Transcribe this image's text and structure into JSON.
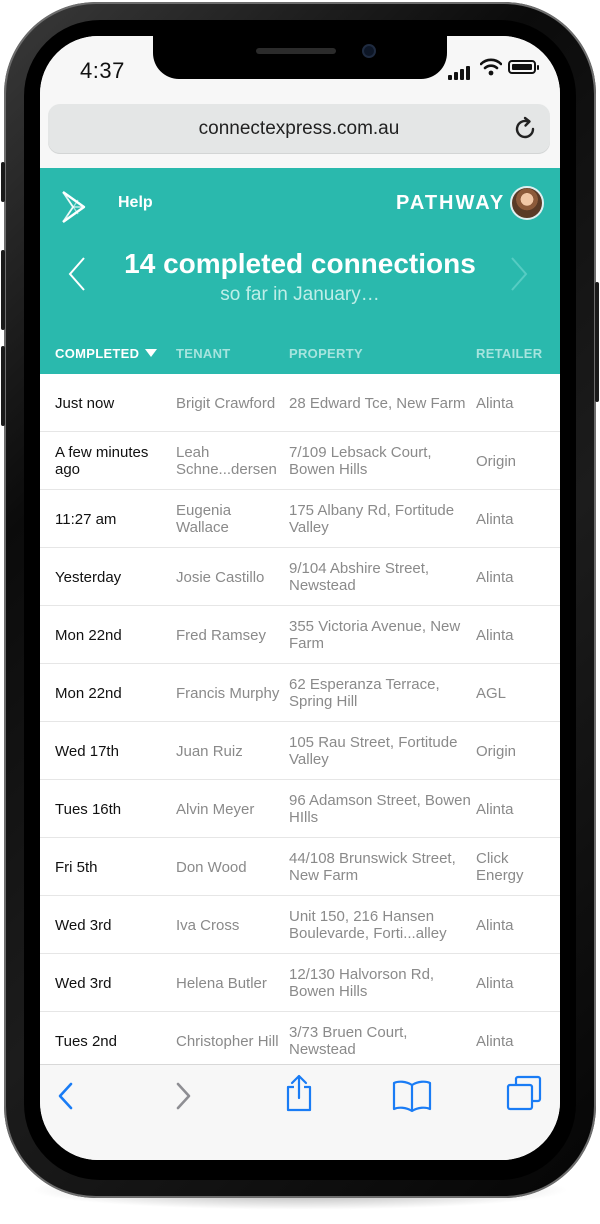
{
  "status_bar": {
    "time": "4:37"
  },
  "browser": {
    "url": "connectexpress.com.au"
  },
  "header": {
    "help_label": "Help",
    "brand": "PATHWAY",
    "headline": "14 completed connections",
    "subline": "so far in January…",
    "accent_color": "#2ab9ad"
  },
  "columns": {
    "completed": "COMPLETED",
    "tenant": "TENANT",
    "property": "PROPERTY",
    "retailer": "RETAILER"
  },
  "rows": [
    {
      "completed": "Just now",
      "tenant": "Brigit Crawford",
      "property": "28 Edward Tce, New Farm",
      "retailer": "Alinta"
    },
    {
      "completed": "A few minutes ago",
      "tenant": "Leah Schne...dersen",
      "property": "7/109 Lebsack Court, Bowen Hills",
      "retailer": "Origin"
    },
    {
      "completed": "11:27 am",
      "tenant": "Eugenia Wallace",
      "property": "175 Albany Rd, Fortitude Valley",
      "retailer": "Alinta"
    },
    {
      "completed": "Yesterday",
      "tenant": "Josie Castillo",
      "property": "9/104 Abshire Street, Newstead",
      "retailer": "Alinta"
    },
    {
      "completed": "Mon 22nd",
      "tenant": "Fred Ramsey",
      "property": "355 Victoria Avenue, New Farm",
      "retailer": "Alinta"
    },
    {
      "completed": "Mon 22nd",
      "tenant": "Francis Murphy",
      "property": "62 Esperanza Terrace, Spring Hill",
      "retailer": "AGL"
    },
    {
      "completed": "Wed 17th",
      "tenant": "Juan Ruiz",
      "property": "105 Rau Street, Fortitude Valley",
      "retailer": "Origin"
    },
    {
      "completed": "Tues 16th",
      "tenant": "Alvin Meyer",
      "property": "96 Adamson Street, Bowen HIlls",
      "retailer": "Alinta"
    },
    {
      "completed": "Fri 5th",
      "tenant": "Don Wood",
      "property": "44/108 Brunswick Street, New Farm",
      "retailer": "Click Energy"
    },
    {
      "completed": "Wed 3rd",
      "tenant": "Iva Cross",
      "property": "Unit 150, 216 Hansen Boulevarde, Forti...alley",
      "retailer": "Alinta"
    },
    {
      "completed": "Wed 3rd",
      "tenant": "Helena Butler",
      "property": "12/130 Halvorson Rd, Bowen Hills",
      "retailer": "Alinta"
    },
    {
      "completed": "Tues 2nd",
      "tenant": "Christopher Hill",
      "property": "3/73 Bruen Court, Newstead",
      "retailer": "Alinta"
    }
  ],
  "icons": {
    "back": "chevron-left-icon",
    "forward": "chevron-right-icon",
    "share": "share-icon",
    "bookmarks": "book-icon",
    "tabs": "tabs-icon"
  }
}
